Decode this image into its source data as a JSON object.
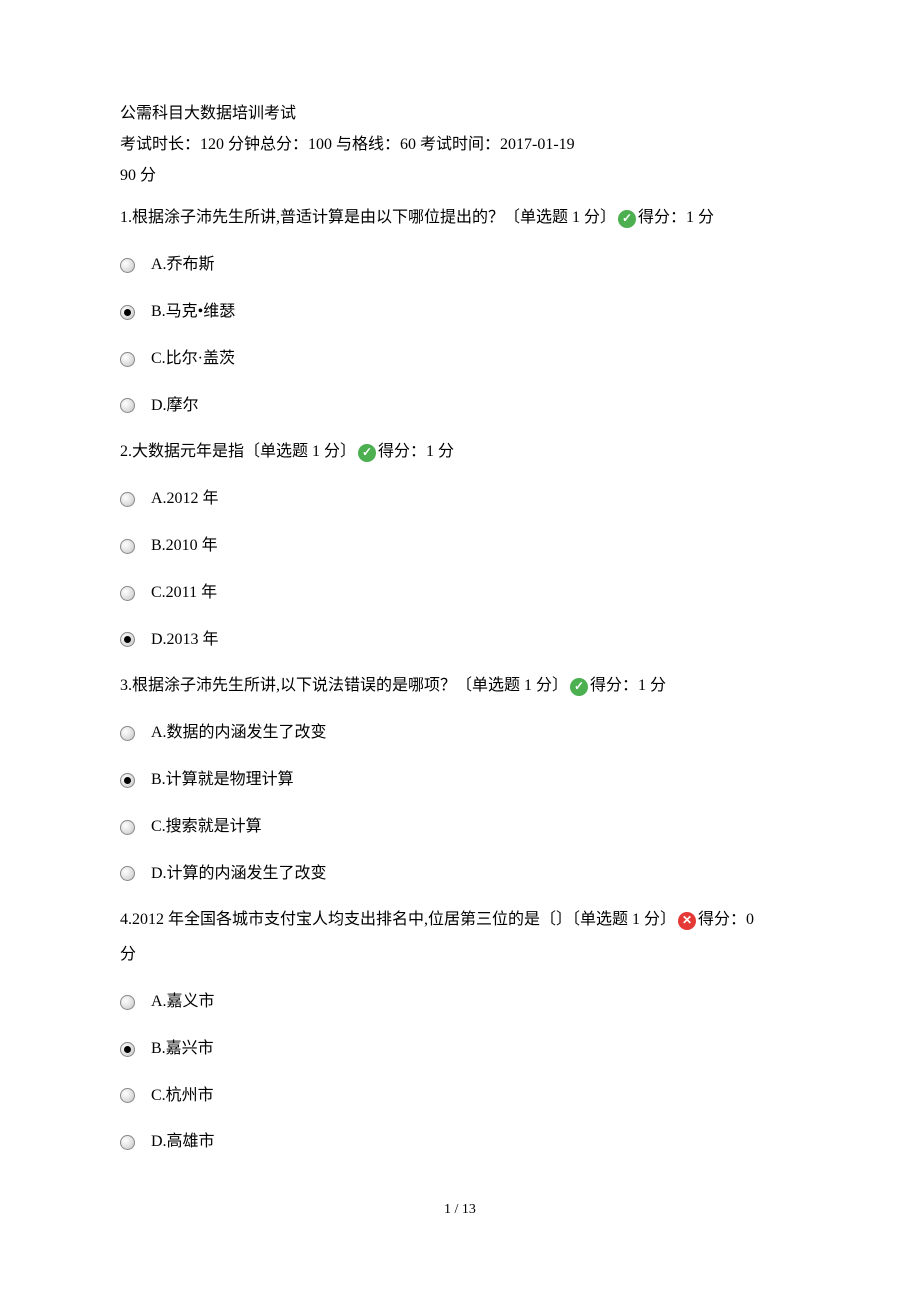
{
  "title": "公需科目大数据培训考试",
  "meta": "考试时长：120 分钟总分：100  与格线：60  考试时间：2017-01-19",
  "score_line": "90 分",
  "questions": [
    {
      "text_prefix": "1.根据涂子沛先生所讲,普适计算是由以下哪位提出的？〔单选题 1 分〕",
      "result": "correct",
      "score_text": "得分：1 分",
      "options": [
        {
          "label": "A.乔布斯",
          "selected": false
        },
        {
          "label": "B.马克•维瑟",
          "selected": true
        },
        {
          "label": "C.比尔·盖茨",
          "selected": false
        },
        {
          "label": "D.摩尔",
          "selected": false
        }
      ]
    },
    {
      "text_prefix": "2.大数据元年是指〔单选题 1 分〕",
      "result": "correct",
      "score_text": "得分：1 分",
      "options": [
        {
          "label": "A.2012 年",
          "selected": false
        },
        {
          "label": "B.2010 年",
          "selected": false
        },
        {
          "label": "C.2011 年",
          "selected": false
        },
        {
          "label": "D.2013 年",
          "selected": true
        }
      ]
    },
    {
      "text_prefix": "3.根据涂子沛先生所讲,以下说法错误的是哪项？〔单选题 1 分〕",
      "result": "correct",
      "score_text": "得分：1 分",
      "options": [
        {
          "label": "A.数据的内涵发生了改变",
          "selected": false
        },
        {
          "label": "B.计算就是物理计算",
          "selected": true
        },
        {
          "label": "C.搜索就是计算",
          "selected": false
        },
        {
          "label": "D.计算的内涵发生了改变",
          "selected": false
        }
      ]
    },
    {
      "text_prefix": "4.2012 年全国各城市支付宝人均支出排名中,位居第三位的是〔〕〔单选题 1 分〕",
      "result": "wrong",
      "score_text": "得分：0",
      "score_text2": "分",
      "options": [
        {
          "label": "A.嘉义市",
          "selected": false
        },
        {
          "label": "B.嘉兴市",
          "selected": true
        },
        {
          "label": "C.杭州市",
          "selected": false
        },
        {
          "label": "D.高雄市",
          "selected": false
        }
      ]
    }
  ],
  "footer": "1  /  13"
}
